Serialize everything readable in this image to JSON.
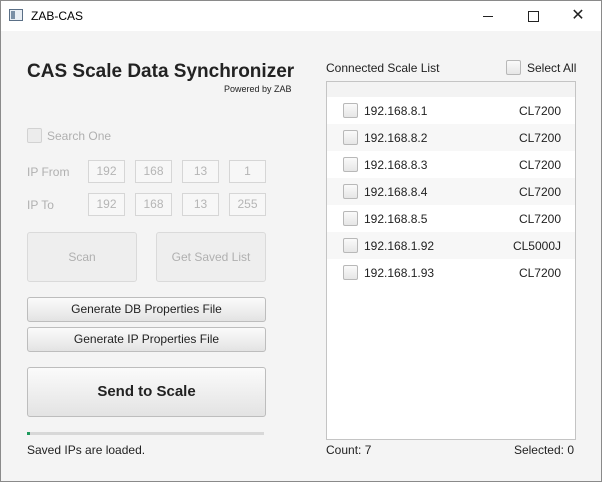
{
  "window": {
    "title": "ZAB-CAS"
  },
  "header": {
    "title": "CAS Scale Data Synchronizer",
    "subtitle": "Powered by ZAB"
  },
  "search": {
    "search_one_label": "Search One",
    "ip_from_label": "IP From",
    "ip_to_label": "IP To",
    "ip_from": [
      "192",
      "168",
      "13",
      "1"
    ],
    "ip_to": [
      "192",
      "168",
      "13",
      "255"
    ]
  },
  "buttons": {
    "scan": "Scan",
    "get_saved_list": "Get Saved List",
    "generate_db": "Generate DB Properties File",
    "generate_ip": "Generate IP Properties File",
    "send_to_scale": "Send to Scale"
  },
  "progress": {
    "fraction": 0.01
  },
  "status": {
    "text": "Saved IPs are loaded."
  },
  "scale_list": {
    "title": "Connected Scale List",
    "select_all_label": "Select All",
    "items": [
      {
        "ip": "192.168.8.1",
        "model": "CL7200"
      },
      {
        "ip": "192.168.8.2",
        "model": "CL7200"
      },
      {
        "ip": "192.168.8.3",
        "model": "CL7200"
      },
      {
        "ip": "192.168.8.4",
        "model": "CL7200"
      },
      {
        "ip": "192.168.8.5",
        "model": "CL7200"
      },
      {
        "ip": "192.168.1.92",
        "model": "CL5000J"
      },
      {
        "ip": "192.168.1.93",
        "model": "CL7200"
      }
    ]
  },
  "footer": {
    "count_text": "Count:  7",
    "selected_text": "Selected:  0"
  },
  "colors": {
    "progress": "#1f9a5e",
    "disabled_text": "#b0b0b0"
  }
}
